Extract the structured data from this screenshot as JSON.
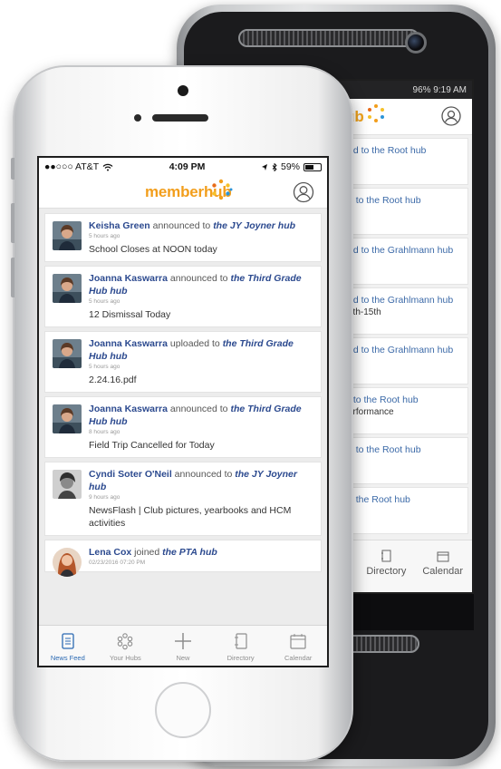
{
  "android": {
    "status_text": "96% 9:19 AM",
    "header": {
      "logo_fragment": "ub"
    },
    "cards": [
      {
        "text": "ed to the Root hub",
        "extra": ""
      },
      {
        "text": "d to the Root hub",
        "extra": ""
      },
      {
        "text": "ed to the Grahlmann hub",
        "extra": ""
      },
      {
        "text": "ed to the Grahlmann hub",
        "extra": "1th-15th"
      },
      {
        "text": "ed to the Grahlmann hub",
        "extra": ""
      },
      {
        "text": "t to the Root hub",
        "extra": "erformance"
      },
      {
        "text": "d to the Root hub",
        "extra": ""
      },
      {
        "text": "o the Root hub",
        "extra": ""
      }
    ],
    "tabs": [
      {
        "label": "Directory",
        "icon": "directory-icon"
      },
      {
        "label": "Calendar",
        "icon": "calendar-icon"
      }
    ]
  },
  "iphone": {
    "status": {
      "carrier": "●●○○○ AT&T",
      "time": "4:09 PM",
      "battery": "59%",
      "battery_level": 0.59
    },
    "header": {
      "logo_member": "member",
      "logo_hub": "hub",
      "profile_icon": "profile-icon"
    },
    "feed": [
      {
        "author": "Keisha Green",
        "action": " announced to ",
        "hub": "the JY Joyner hub",
        "time": "5 hours ago",
        "body": "School Closes at NOON today",
        "avatar": "photo"
      },
      {
        "author": "Joanna Kaswarra",
        "action": " announced to ",
        "hub": "the Third Grade Hub hub",
        "time": "5 hours ago",
        "body": "12 Dismissal Today",
        "avatar": "photo"
      },
      {
        "author": "Joanna Kaswarra",
        "action": " uploaded to ",
        "hub": "the Third Grade Hub hub",
        "time": "5 hours ago",
        "body": "2.24.16.pdf",
        "avatar": "photo"
      },
      {
        "author": "Joanna Kaswarra",
        "action": " announced to ",
        "hub": "the Third Grade Hub hub",
        "time": "8 hours ago",
        "body": "Field Trip Cancelled for Today",
        "avatar": "photo"
      },
      {
        "author": "Cyndi Soter O'Neil",
        "action": " announced to ",
        "hub": "the JY Joyner hub",
        "time": "9 hours ago",
        "body": "NewsFlash | Club pictures, yearbooks and HCM activities",
        "avatar": "photo-bw"
      },
      {
        "author": "Lena Cox",
        "action": " joined ",
        "hub": "the PTA hub",
        "time": "02/23/2016 07:20 PM",
        "body": "",
        "avatar": "photo-round"
      }
    ],
    "tabs": [
      {
        "label": "News Feed",
        "icon": "news-feed-icon",
        "active": true
      },
      {
        "label": "Your Hubs",
        "icon": "hubs-icon",
        "active": false
      },
      {
        "label": "New",
        "icon": "plus-icon",
        "active": false
      },
      {
        "label": "Directory",
        "icon": "directory-icon",
        "active": false
      },
      {
        "label": "Calendar",
        "icon": "calendar-icon",
        "active": false
      }
    ]
  },
  "colors": {
    "brand_orange": "#f29e1c",
    "link_blue": "#2c4a8f",
    "active_tab": "#2c6ab3"
  }
}
